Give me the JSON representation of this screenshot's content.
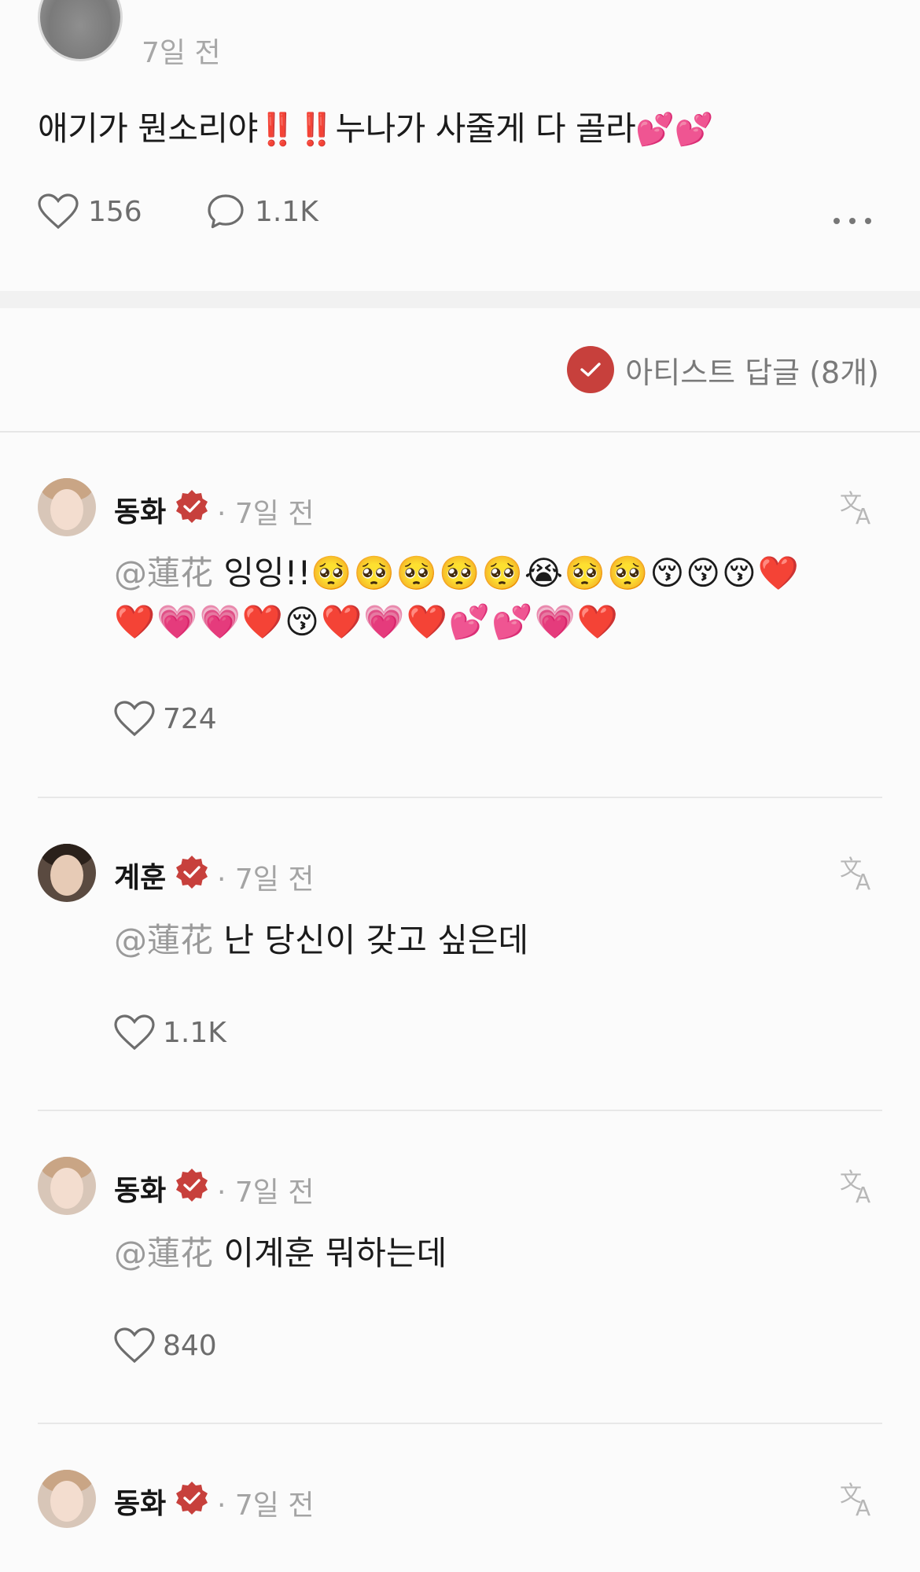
{
  "post": {
    "time": "7일 전",
    "text": "애기가 뭔소리야",
    "emoji_alert": "‼️‼️",
    "text2": "누나가 사줄게 다 골라",
    "emoji_end": "💕💕",
    "likes": "156",
    "comments": "1.1K",
    "more_icon": "more-horizontal-icon"
  },
  "filter": {
    "label": "아티스트 답글 (8개)",
    "accent": "#c7403c"
  },
  "comments": [
    {
      "name": "동화",
      "time": "7일 전",
      "mention": "@蓮花",
      "text": "잉잉!!",
      "emoji1": "🥺🥺🥺🥺🥺😭🥺🥺😚😚😚❤️",
      "emoji2": "❤️💗💗❤️😚❤️💗❤️💕💕💗❤️",
      "likes": "724"
    },
    {
      "name": "계훈",
      "time": "7일 전",
      "mention": "@蓮花",
      "text": "난 당신이 갖고 싶은데",
      "likes": "1.1K"
    },
    {
      "name": "동화",
      "time": "7일 전",
      "mention": "@蓮花",
      "text": "이계훈 뭐하는데",
      "likes": "840"
    },
    {
      "name": "동화",
      "time": "7일 전"
    }
  ],
  "dot_separator": "·"
}
